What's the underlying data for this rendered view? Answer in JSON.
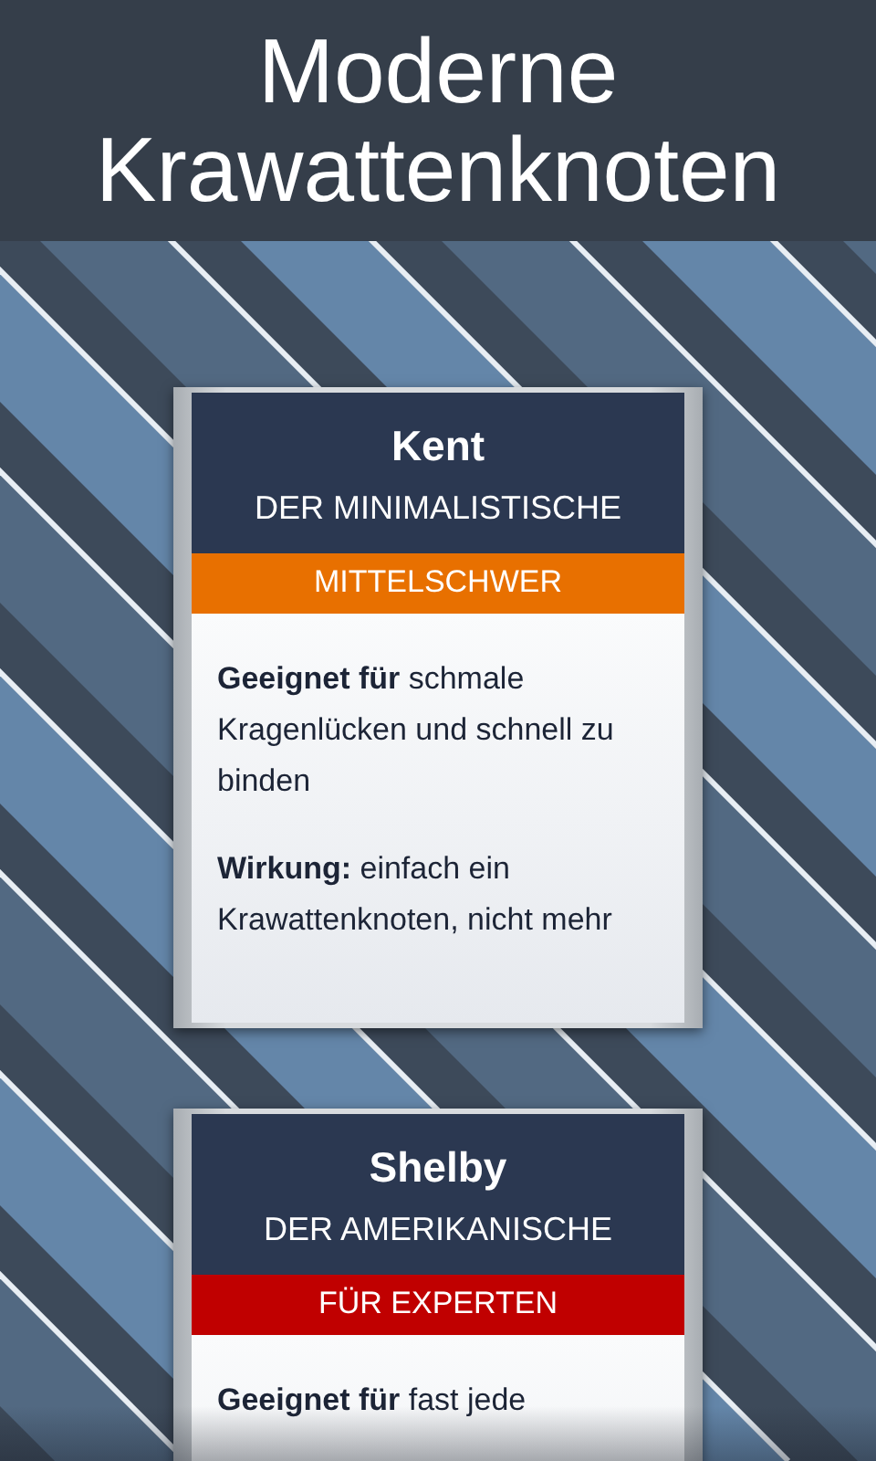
{
  "title": "Moderne Krawattenknoten",
  "knots": [
    {
      "name": "Kent",
      "subtitle": "DER MINIMALISTISCHE",
      "difficulty": {
        "label": "MITTELSCHWER",
        "color": "#e87000"
      },
      "paragraphs": [
        "**Geeignet für** schmale Kragenlücken und schnell zu binden",
        "**Wirkung:** einfach ein Krawattenknoten, nicht mehr"
      ]
    },
    {
      "name": "Shelby",
      "subtitle": "DER AMERIKANISCHE",
      "difficulty": {
        "label": "FÜR EXPERTEN",
        "color": "#c00000"
      },
      "paragraphs": [
        "**Geeignet für** fast jede"
      ]
    }
  ]
}
